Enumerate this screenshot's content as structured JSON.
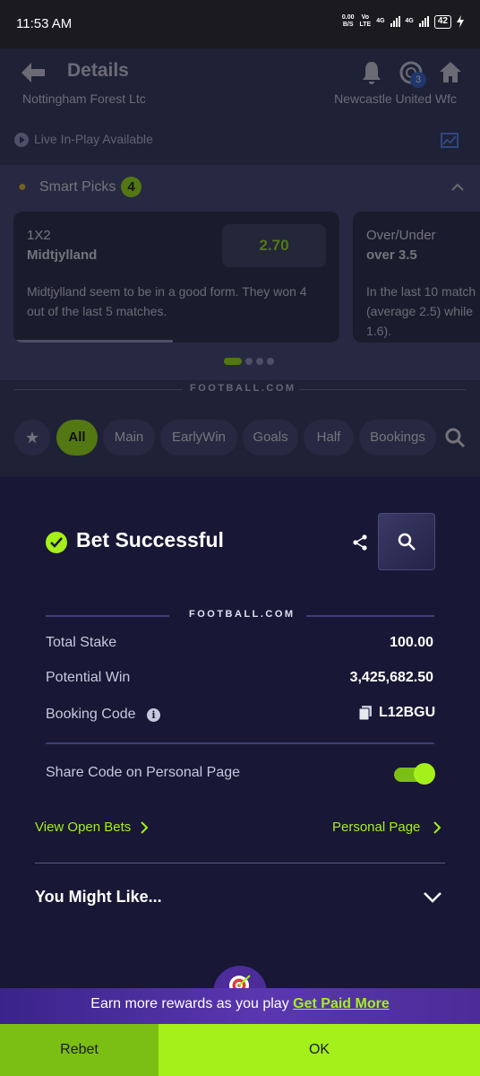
{
  "status_bar": {
    "time": "11:53 AM",
    "net_speed": "0.00",
    "net_unit": "B/S",
    "volte": "Vo",
    "lte": "LTE",
    "net1": "4G",
    "net2": "4G",
    "battery": "42"
  },
  "header": {
    "title": "Details",
    "coins_badge": "3"
  },
  "match": {
    "home_team": "Nottingham Forest Ltc",
    "away_team": "Newcastle United Wfc",
    "live_label": "Live In-Play Available"
  },
  "smart_picks": {
    "title": "Smart Picks",
    "count": "4",
    "cards": [
      {
        "market": "1X2",
        "selection": "Midtjylland",
        "odds": "2.70",
        "description": "Midtjylland seem to be in a good form. They won 4 out of the last 5 matches."
      },
      {
        "market": "Over/Under",
        "selection": "over 3.5",
        "description_line1": "In the last 10 match",
        "description_line2": "(average 2.5) while",
        "description_line3": "1.6)."
      }
    ]
  },
  "brand": "FOOTBALL.COM",
  "market_tabs": [
    "All",
    "Main",
    "EarlyWin",
    "Goals",
    "Half",
    "Bookings"
  ],
  "bet_sheet": {
    "title": "Bet Successful",
    "brand": "FOOTBALL.COM",
    "total_stake_label": "Total Stake",
    "total_stake": "100.00",
    "potential_win_label": "Potential Win",
    "potential_win": "3,425,682.50",
    "booking_code_label": "Booking Code",
    "booking_code": "L12BGU",
    "share_label": "Share Code on Personal Page",
    "share_enabled": true,
    "view_open_bets": "View Open Bets",
    "personal_page": "Personal Page",
    "you_might_like": "You Might Like..."
  },
  "rewards": {
    "text": "Earn more rewards as you play",
    "link": "Get Paid More"
  },
  "footer": {
    "rebet": "Rebet",
    "ok": "OK"
  },
  "colors": {
    "accent": "#a5f01a",
    "sheet": "#181735",
    "rebet": "#7cbf14"
  }
}
